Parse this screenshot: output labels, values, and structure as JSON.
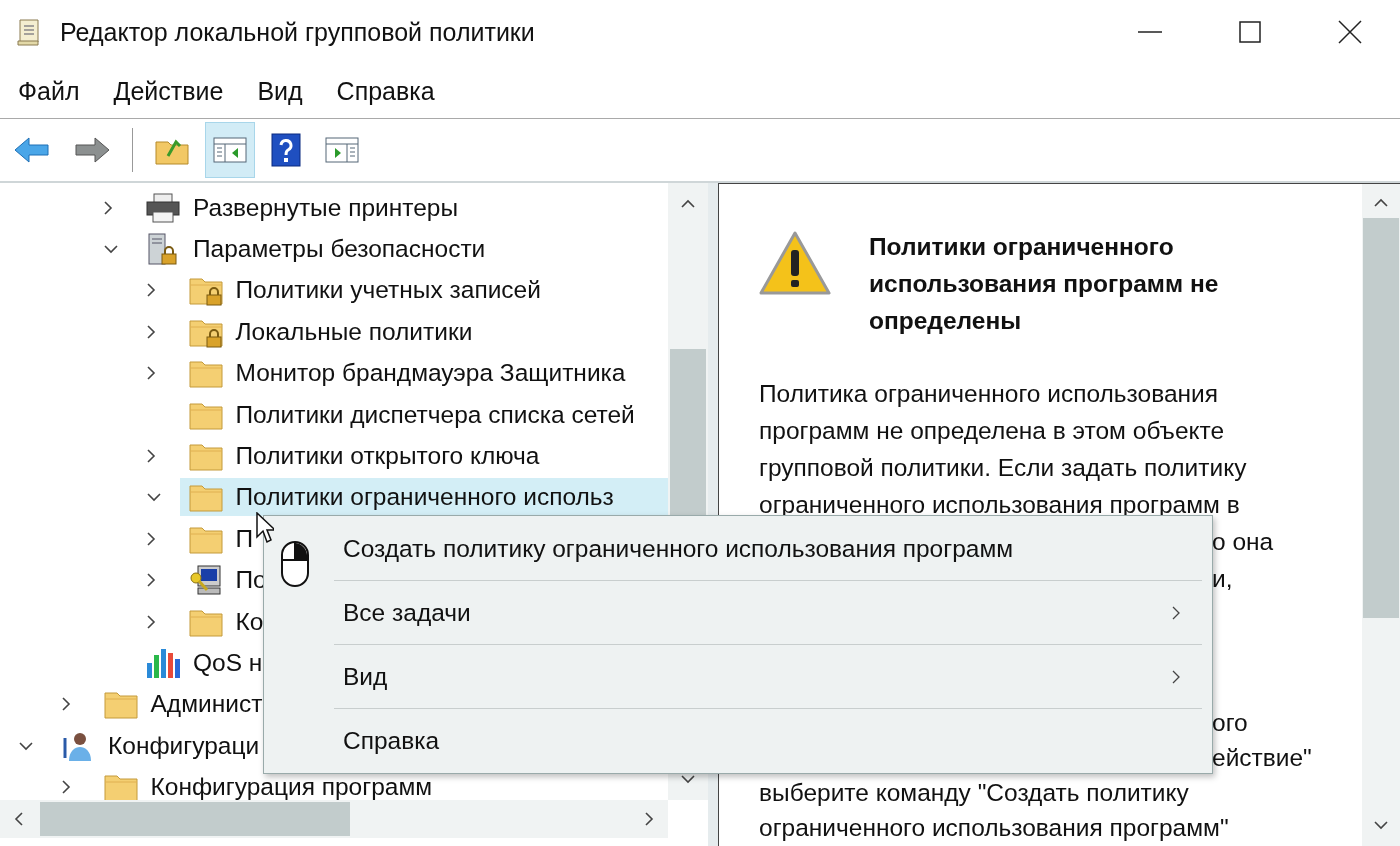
{
  "window": {
    "title": "Редактор локальной групповой политики"
  },
  "menu_bar": [
    "Файл",
    "Действие",
    "Вид",
    "Справка"
  ],
  "toolbar": [
    {
      "kind": "back",
      "pressed": false
    },
    {
      "kind": "forward",
      "pressed": false
    },
    {
      "kind": "up-folder",
      "pressed": false
    },
    {
      "kind": "tree-toggle",
      "pressed": true
    },
    {
      "kind": "help",
      "pressed": false
    },
    {
      "kind": "action-pane",
      "pressed": false
    }
  ],
  "tree": {
    "items": [
      {
        "children": [
          {
            "children": [
              {
                "label": "Развернутые принтеры",
                "kind": "printer",
                "expanded": false,
                "selected": false
              },
              {
                "label": "Параметры безопасности",
                "kind": "server-lock",
                "expanded": true,
                "selected": false,
                "children": [
                  {
                    "label": "Политики учетных записей",
                    "kind": "folder-lock",
                    "expanded": false,
                    "selected": false
                  },
                  {
                    "label": "Локальные политики",
                    "kind": "folder-lock",
                    "expanded": false,
                    "selected": false
                  },
                  {
                    "label": "Монитор брандмауэра Защитника",
                    "kind": "folder",
                    "expanded": false,
                    "selected": false
                  },
                  {
                    "label": "Политики диспетчера списка сетей",
                    "kind": "folder",
                    "selected": false
                  },
                  {
                    "label": "Политики открытого ключа",
                    "kind": "folder",
                    "expanded": false,
                    "selected": false
                  },
                  {
                    "label": "Политики ограниченного использ",
                    "kind": "folder",
                    "expanded": true,
                    "selected": true
                  },
                  {
                    "label": "П",
                    "kind": "folder",
                    "expanded": false,
                    "selected": false
                  },
                  {
                    "label": "По",
                    "kind": "computer-key",
                    "expanded": false,
                    "selected": false
                  },
                  {
                    "label": "Ко",
                    "kind": "folder",
                    "expanded": false,
                    "selected": false
                  }
                ]
              },
              {
                "label": "QoS н",
                "kind": "chart",
                "selected": false
              }
            ]
          },
          {
            "label": "Админист",
            "kind": "folder",
            "expanded": false,
            "selected": false
          }
        ]
      },
      {
        "label": "Конфигураци",
        "kind": "user",
        "expanded": true,
        "selected": false,
        "children": [
          {
            "label": "Конфигурация программ",
            "kind": "folder",
            "expanded": false,
            "selected": false
          }
        ]
      }
    ]
  },
  "details": {
    "heading": "Политики ограниченного использования программ не определены",
    "paragraph_1": [
      {
        "text": "Политика ограниченного использования",
        "kind": "full"
      },
      {
        "text": "программ не определена в этом объекте",
        "kind": "full"
      },
      {
        "text": "групповой политики. Если задать политику",
        "kind": "full"
      },
      {
        "text": "ограниченного использования программ в",
        "kind": "full"
      },
      {
        "text": "о она",
        "kind": "partial"
      },
      {
        "text": "и,",
        "kind": "partial"
      }
    ],
    "paragraph_2": [
      {
        "text": "ого",
        "kind": "partial"
      },
      {
        "text": "ействие\"",
        "kind": "partial"
      },
      {
        "text": "выберите команду \"Создать политику",
        "kind": "full"
      },
      {
        "text": "ограниченного использования программ\"",
        "kind": "full"
      }
    ]
  },
  "context_menu": [
    {
      "label": "Создать политику ограниченного использования программ",
      "submenu": false
    },
    {
      "label": "Все задачи",
      "submenu": true
    },
    {
      "label": "Вид",
      "submenu": true
    },
    {
      "label": "Справка",
      "submenu": false
    }
  ]
}
